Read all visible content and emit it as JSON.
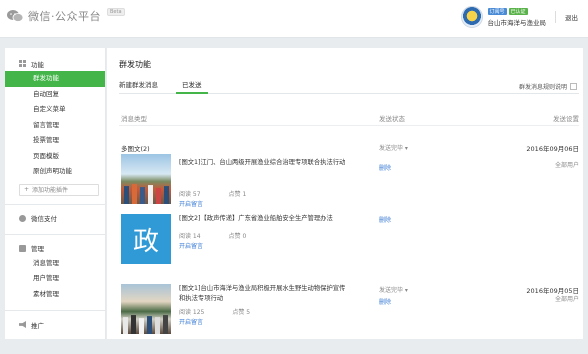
{
  "header": {
    "logo_text": "微信·公众平台",
    "beta_label": "Beta",
    "account_badges": [
      "订阅号",
      "已认证"
    ],
    "account_name": "台山市海洋与渔业局",
    "logout_label": "退出",
    "colors": {
      "accent": "#44b549",
      "link": "#3a7bd5"
    }
  },
  "sidebar": {
    "sections": [
      {
        "title": "功能",
        "icon": "grid-icon",
        "items": [
          "群发功能",
          "自动回复",
          "自定义菜单",
          "留言管理",
          "投票管理",
          "页面模版",
          "原创声明功能"
        ]
      },
      {
        "title": "微信支付",
        "icon": "wallet-icon",
        "items": []
      },
      {
        "title": "管理",
        "icon": "manage-icon",
        "items": [
          "消息管理",
          "用户管理",
          "素材管理"
        ]
      },
      {
        "title": "推广",
        "icon": "megaphone-icon",
        "items": []
      }
    ],
    "active_item": "群发功能",
    "add_plugin_label": "添加功能插件"
  },
  "main": {
    "title": "群发功能",
    "tabs": [
      {
        "label": "新建群发消息",
        "active": false
      },
      {
        "label": "已发送",
        "active": true
      }
    ],
    "rules_label": "群发消息规则说明",
    "columns": {
      "type": "消息类型",
      "status": "发送状态",
      "settings": "发送设置"
    },
    "groups": [
      {
        "type": "多图文(2)",
        "status": "发送完毕 ▾",
        "date": "2016年09月06日",
        "articles": [
          {
            "title": "[图文1]江门、台山两级开展渔业综合治理专项联合执法行动",
            "reads_label": "阅读 57",
            "likes_label": "点赞 1",
            "comment_label": "开启留言",
            "delete_label": "删除",
            "users_label": "全部用户",
            "thumb": "photo"
          },
          {
            "title": "[图文2]【政声传递】广东省渔业船舶安全生产管理办法",
            "reads_label": "阅读 14",
            "likes_label": "点赞 0",
            "comment_label": "开启留言",
            "delete_label": "删除",
            "users_label": "",
            "thumb": "政"
          }
        ]
      },
      {
        "type": "",
        "status": "发送完毕 ▾",
        "date": "2016年09月05日",
        "articles": [
          {
            "title": "[图文1]台山市海洋与渔业局积极开展水生野生动物保护宣传和执法专项行动",
            "reads_label": "阅读 125",
            "likes_label": "点赞 5",
            "comment_label": "开启留言",
            "delete_label": "删除",
            "users_label": "全部用户",
            "thumb": "photo"
          }
        ]
      }
    ]
  }
}
